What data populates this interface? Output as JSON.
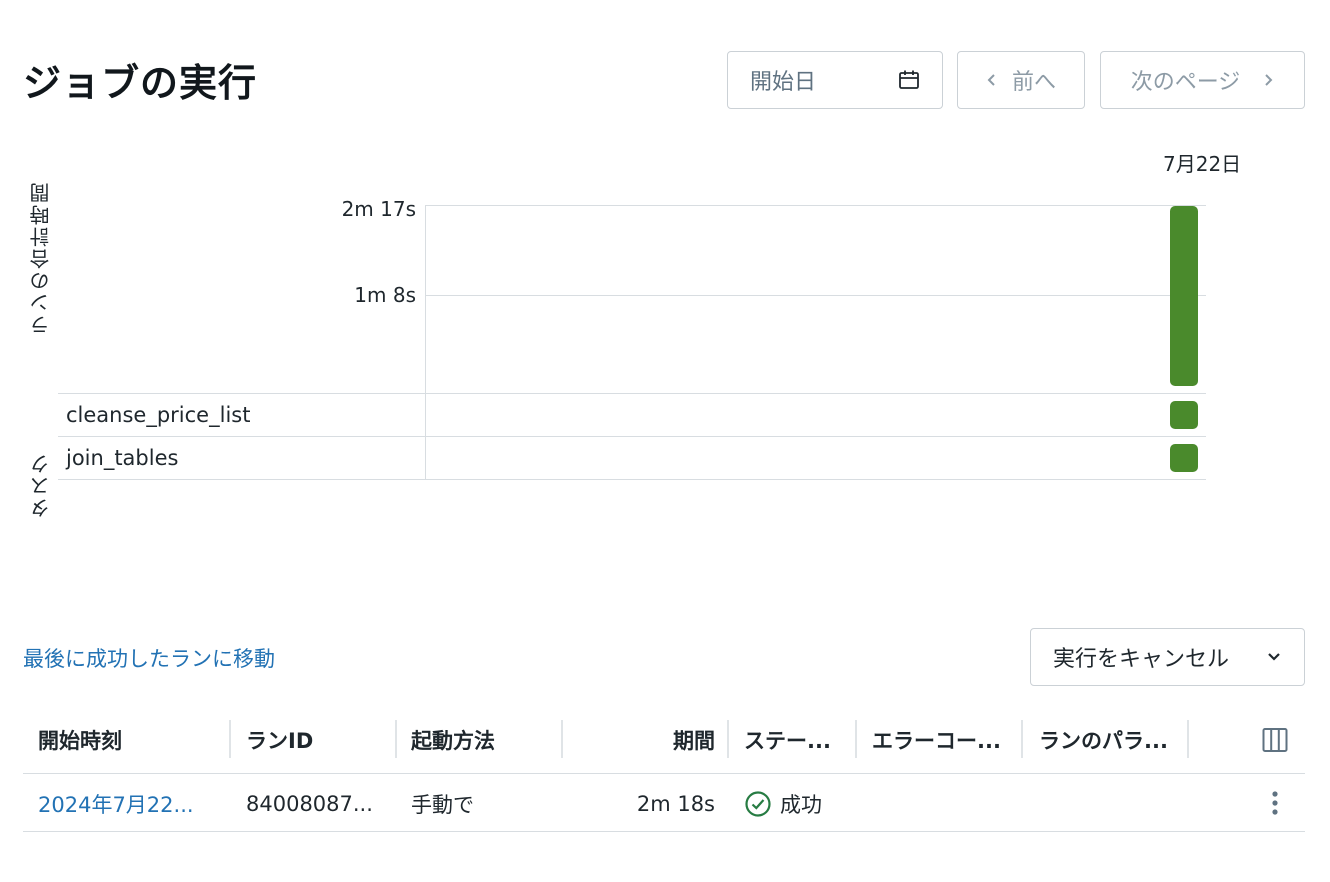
{
  "header": {
    "title": "ジョブの実行"
  },
  "controls": {
    "start_date_placeholder": "開始日",
    "prev_label": "前へ",
    "next_label": "次のページ"
  },
  "chart": {
    "date_label": "7月22日",
    "y_axis_label": "ランの合計時間",
    "y_ticks": [
      "2m 17s",
      "1m 8s"
    ],
    "task_axis_label": "タスク",
    "tasks": [
      "cleanse_price_list",
      "join_tables"
    ],
    "bar_color": "#4a8a2c"
  },
  "chart_data": {
    "type": "bar",
    "categories": [
      "7月22日"
    ],
    "series": [
      {
        "values": [
          137
        ]
      }
    ],
    "ylabel": "ランの合計時間",
    "ylim": [
      0,
      137
    ],
    "y_tick_labels": [
      "2m 17s",
      "1m 8s"
    ],
    "tasks": [
      "cleanse_price_list",
      "join_tables"
    ],
    "grid": true
  },
  "actions": {
    "last_success_link": "最後に成功したランに移動",
    "cancel_runs_label": "実行をキャンセル"
  },
  "table": {
    "columns": [
      "開始時刻",
      "ランID",
      "起動方法",
      "期間",
      "ステー...",
      "エラーコー...",
      "ランのパラ..."
    ],
    "rows": [
      {
        "start_time": "2024年7月22...",
        "run_id": "84008087...",
        "launched": "手動で",
        "duration": "2m 18s",
        "status": "成功",
        "error_code": "",
        "params": ""
      }
    ]
  },
  "colors": {
    "accent": "#2272b4",
    "success": "#277c43",
    "bar": "#4a8a2c"
  }
}
